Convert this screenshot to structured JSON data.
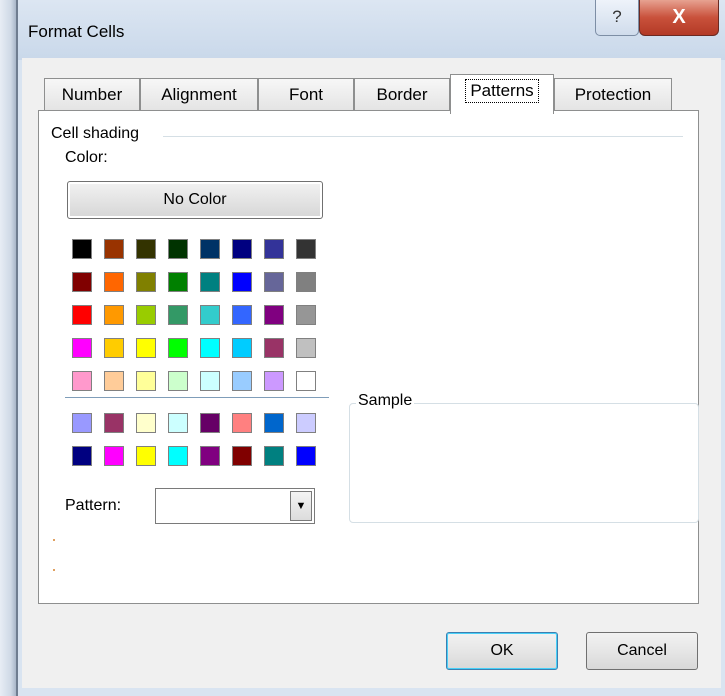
{
  "window": {
    "title": "Format Cells",
    "help_glyph": "?",
    "close_glyph": "X"
  },
  "tabs": [
    {
      "label": "Number"
    },
    {
      "label": "Alignment"
    },
    {
      "label": "Font"
    },
    {
      "label": "Border"
    },
    {
      "label": "Patterns",
      "active": true
    },
    {
      "label": "Protection"
    }
  ],
  "shading": {
    "group_label": "Cell shading",
    "color_label": "Color:",
    "no_color_label": "No Color",
    "palette_main": [
      [
        "#000000",
        "#993300",
        "#333300",
        "#003300",
        "#003366",
        "#000080",
        "#333399",
        "#333333"
      ],
      [
        "#800000",
        "#ff6600",
        "#808000",
        "#008000",
        "#008080",
        "#0000ff",
        "#666699",
        "#808080"
      ],
      [
        "#ff0000",
        "#ff9900",
        "#99cc00",
        "#339966",
        "#33cccc",
        "#3366ff",
        "#800080",
        "#969696"
      ],
      [
        "#ff00ff",
        "#ffcc00",
        "#ffff00",
        "#00ff00",
        "#00ffff",
        "#00ccff",
        "#993366",
        "#c0c0c0"
      ],
      [
        "#ff99cc",
        "#ffcc99",
        "#ffff99",
        "#ccffcc",
        "#ccffff",
        "#99ccff",
        "#cc99ff",
        "#ffffff"
      ]
    ],
    "palette_chart": [
      [
        "#9999ff",
        "#993366",
        "#ffffcc",
        "#ccffff",
        "#660066",
        "#ff8080",
        "#0066cc",
        "#ccccff"
      ],
      [
        "#000080",
        "#ff00ff",
        "#ffff00",
        "#00ffff",
        "#800080",
        "#800000",
        "#008080",
        "#0000ff"
      ]
    ],
    "pattern_label": "Pattern:",
    "pattern_value": ""
  },
  "sample": {
    "label": "Sample"
  },
  "buttons": {
    "ok": "OK",
    "cancel": "Cancel"
  }
}
